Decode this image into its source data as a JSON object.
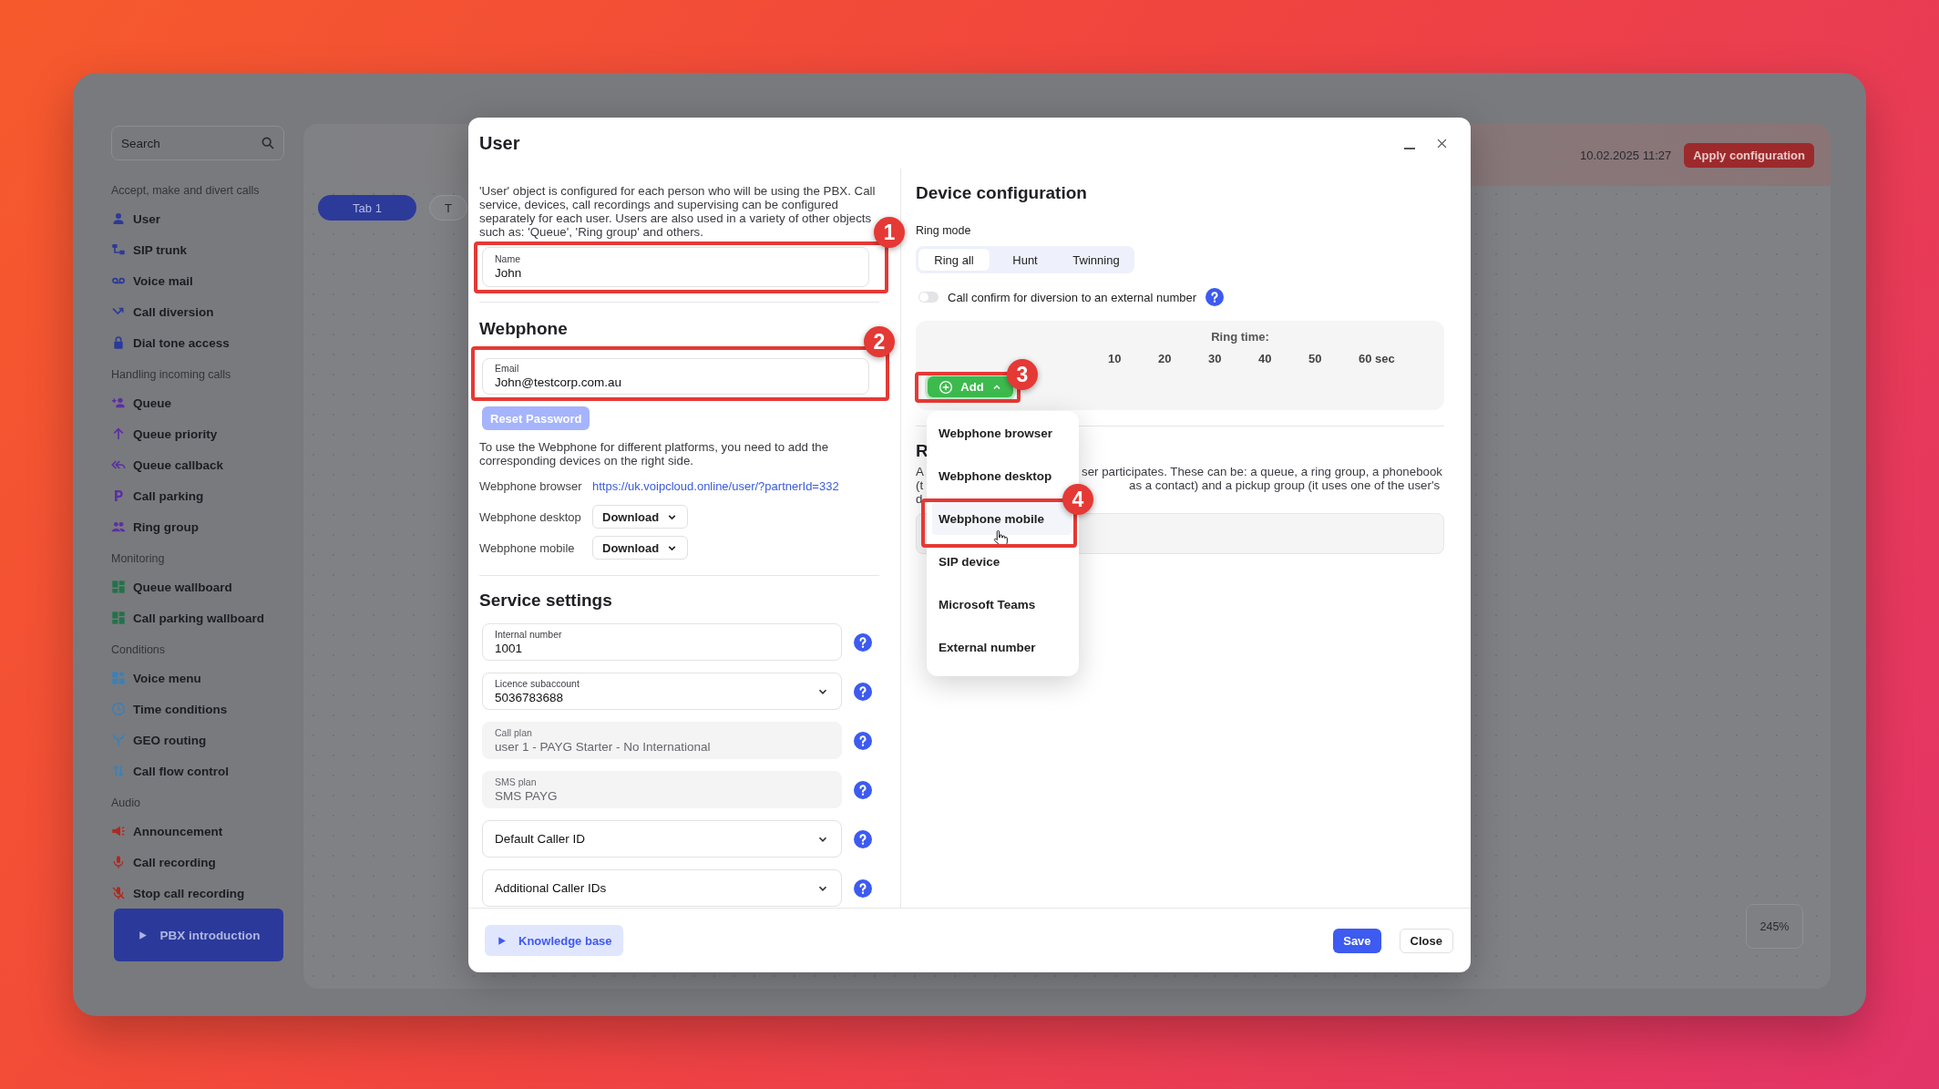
{
  "sidebar": {
    "search": {
      "placeholder": "Search"
    },
    "groups": [
      {
        "heading": "Accept, make and divert calls",
        "items": [
          "User",
          "SIP trunk",
          "Voice mail",
          "Call diversion",
          "Dial tone access"
        ]
      },
      {
        "heading": "Handling incoming calls",
        "items": [
          "Queue",
          "Queue priority",
          "Queue callback",
          "Call parking",
          "Ring group"
        ]
      },
      {
        "heading": "Monitoring",
        "items": [
          "Queue wallboard",
          "Call parking wallboard"
        ]
      },
      {
        "heading": "Conditions",
        "items": [
          "Voice menu",
          "Time conditions",
          "GEO routing",
          "Call flow control"
        ]
      },
      {
        "heading": "Audio",
        "items": [
          "Announcement",
          "Call recording",
          "Stop call recording"
        ]
      }
    ],
    "intro_button": "PBX introduction"
  },
  "workspace": {
    "timestamp": "10.02.2025 11:27",
    "apply_button": "Apply configuration",
    "tabs": [
      {
        "label": "Tab 1",
        "selected": true
      },
      {
        "label": "T",
        "selected": false
      }
    ],
    "zoom": "245%"
  },
  "dialog": {
    "title": "User",
    "left": {
      "description": "'User' object is configured for each person who will be using the PBX. Call service, devices, call recordings and supervising can be configured separately for each user. Users are also used in a variety of other objects such as: 'Queue', 'Ring group' and others.",
      "name_field": {
        "label": "Name",
        "value": "John"
      },
      "webphone": {
        "heading": "Webphone",
        "email_field": {
          "label": "Email",
          "value": "John@testcorp.com.au"
        },
        "reset_button": {
          "label": "Reset Password",
          "disabled": true
        },
        "hint": "To use the Webphone for different platforms, you need to add the corresponding devices on the right side.",
        "rows": [
          {
            "kind": "link",
            "label": "Webphone browser",
            "value": "https://uk.voipcloud.online/user/?partnerId=332"
          },
          {
            "kind": "download",
            "label": "Webphone desktop",
            "value": "Download"
          },
          {
            "kind": "download",
            "label": "Webphone mobile",
            "value": "Download"
          }
        ]
      },
      "service": {
        "heading": "Service settings",
        "fields": [
          {
            "kind": "text",
            "label": "Internal number",
            "value": "1001",
            "disabled": false
          },
          {
            "kind": "select",
            "label": "Licence subaccount",
            "value": "5036783688",
            "disabled": false
          },
          {
            "kind": "text",
            "label": "Call plan",
            "value": "user 1 - PAYG Starter - No International",
            "disabled": true
          },
          {
            "kind": "text",
            "label": "SMS plan",
            "value": "SMS PAYG",
            "disabled": true
          },
          {
            "kind": "select",
            "label": "Default Caller ID",
            "disabled": false
          },
          {
            "kind": "select",
            "label": "Additional Caller IDs",
            "disabled": false
          }
        ]
      }
    },
    "right": {
      "heading": "Device configuration",
      "ring_mode": {
        "label": "Ring mode",
        "options": [
          {
            "label": "Ring all",
            "selected": true
          },
          {
            "label": "Hunt",
            "selected": false
          },
          {
            "label": "Twinning",
            "selected": false
          }
        ]
      },
      "call_confirm": {
        "label": "Call confirm for diversion to an external number",
        "on": false
      },
      "ring_time": {
        "title": "Ring time:",
        "ticks": [
          "10",
          "20",
          "30",
          "40",
          "50",
          "60 sec"
        ]
      },
      "add_button": {
        "label": "Add",
        "expanded": true
      },
      "add_menu": [
        {
          "label": "Webphone browser",
          "selected": false
        },
        {
          "label": "Webphone desktop",
          "selected": false
        },
        {
          "label": "Webphone mobile",
          "selected": true
        },
        {
          "label": "SIP device",
          "selected": false
        },
        {
          "label": "Microsoft Teams",
          "selected": false
        },
        {
          "label": "External number",
          "selected": false
        }
      ],
      "section": {
        "heading": "R",
        "lines": [
          {
            "left": "A",
            "right": "ser participates. These can be: a queue, a ring group, a phonebook"
          },
          {
            "left": "(t",
            "right": "as a contact) and a pickup group (it uses one of the user's"
          },
          {
            "left": "d"
          }
        ]
      }
    },
    "footer": {
      "knowledge_button": "Knowledge base",
      "buttons": [
        {
          "label": "Save",
          "kind": "primary"
        },
        {
          "label": "Close",
          "kind": "secondary"
        }
      ]
    }
  },
  "annotations": [
    {
      "number": "1"
    },
    {
      "number": "2"
    },
    {
      "number": "3"
    },
    {
      "number": "4"
    }
  ]
}
